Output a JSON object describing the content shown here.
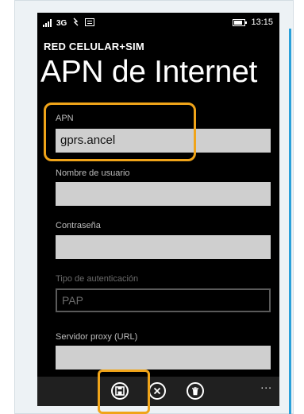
{
  "status_bar": {
    "network": "3G",
    "time": "13:15"
  },
  "header": {
    "section": "RED CELULAR+SIM",
    "title": "APN de Internet"
  },
  "fields": {
    "apn": {
      "label": "APN",
      "value": "gprs.ancel"
    },
    "username": {
      "label": "Nombre de usuario",
      "value": ""
    },
    "password": {
      "label": "Contraseña",
      "value": ""
    },
    "auth_type": {
      "label": "Tipo de autenticación",
      "value": "PAP"
    },
    "proxy": {
      "label": "Servidor proxy (URL)",
      "value": ""
    }
  },
  "app_bar": {
    "more_label": "...",
    "buttons": [
      "save-icon",
      "cancel-icon",
      "delete-icon"
    ]
  },
  "colors": {
    "highlight": "#f0a419",
    "accent": "#2aa0d9",
    "input_bg": "#cfcfcf"
  }
}
